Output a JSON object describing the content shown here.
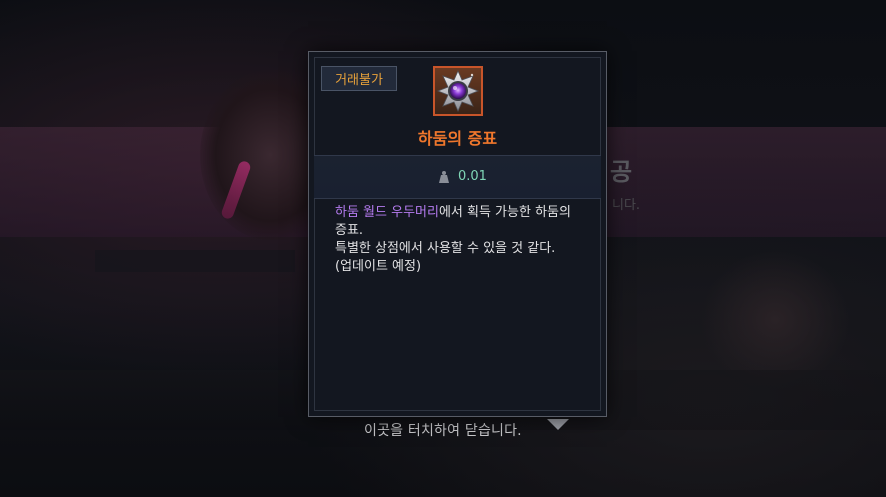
{
  "background": {
    "title": "공",
    "subtitle": "니다.",
    "close_hint": "이곳을 터치하여 닫습니다."
  },
  "tooltip": {
    "trade_tag": "거래불가",
    "item_icon": "hadum-badge-icon",
    "item_name": "하둠의 증표",
    "weight_icon": "weight-icon",
    "weight": "0.01",
    "desc_highlight": "하둠 월드 우두머리",
    "desc_line1_rest": "에서 획득 가능한 하둠의",
    "desc_line2": "증표.",
    "desc_line3": "특별한 상점에서 사용할 수 있을 것 같다.",
    "desc_line4": "(업데이트 예정)"
  },
  "colors": {
    "item_name": "#f0772c",
    "trade_tag": "#e8a23a",
    "weight": "#7fd6b6",
    "highlight": "#b57bf0"
  }
}
